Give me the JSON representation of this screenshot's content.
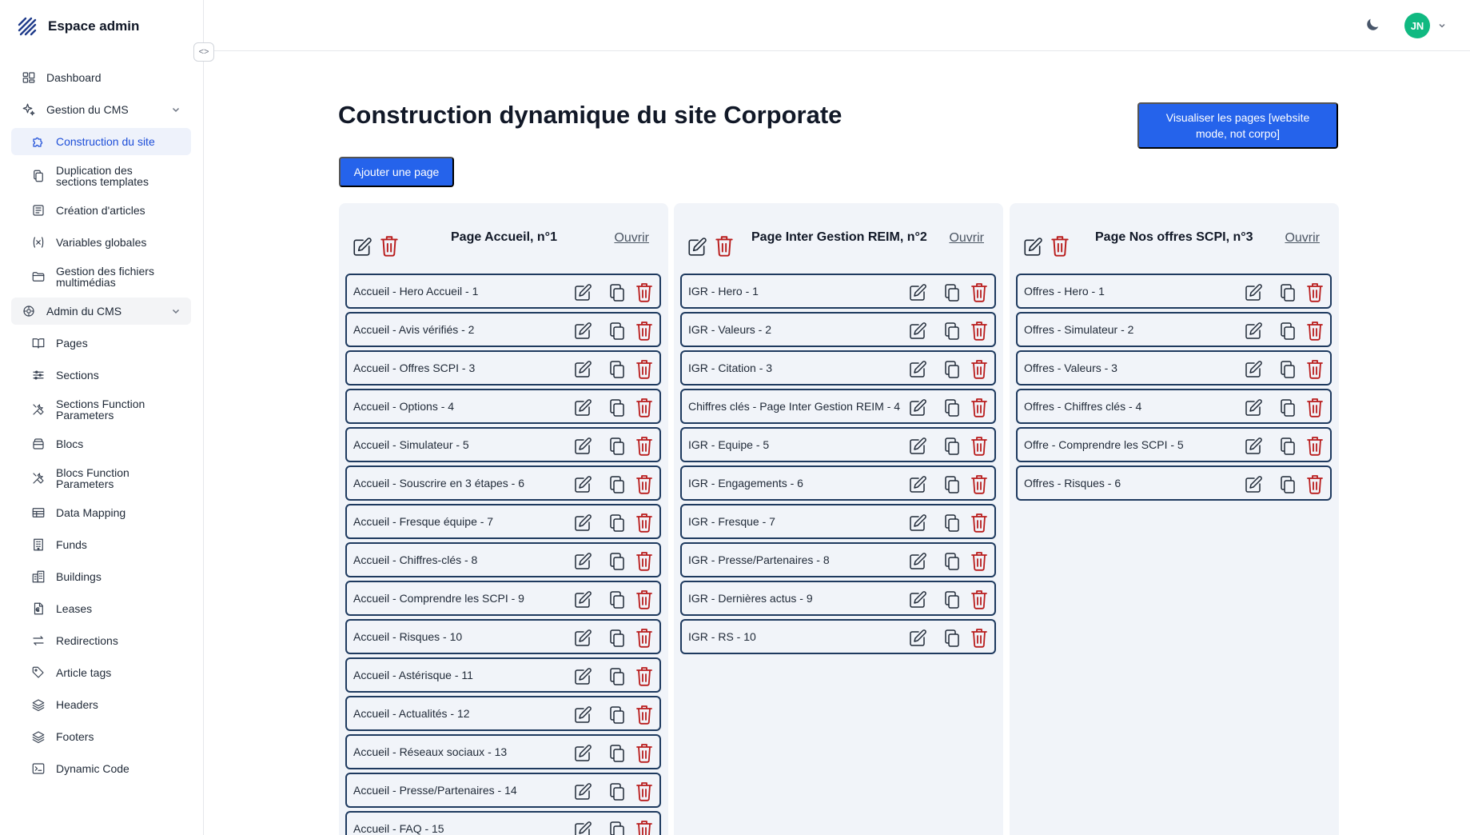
{
  "app": {
    "title": "Espace admin"
  },
  "topbar": {
    "avatar_initials": "JN",
    "theme_icon": "moon-icon"
  },
  "sidebar": {
    "items": [
      {
        "label": "Dashboard",
        "icon": "dashboard-icon",
        "type": "item"
      },
      {
        "label": "Gestion du CMS",
        "icon": "sparkles-icon",
        "type": "group"
      },
      {
        "label": "Construction du site",
        "icon": "puzzle-icon",
        "type": "sub",
        "active": true
      },
      {
        "label": "Duplication des sections templates",
        "icon": "copy-icon",
        "type": "sub"
      },
      {
        "label": "Création d'articles",
        "icon": "newspaper-icon",
        "type": "sub"
      },
      {
        "label": "Variables globales",
        "icon": "variable-icon",
        "type": "sub"
      },
      {
        "label": "Gestion des fichiers multimédias",
        "icon": "folder-icon",
        "type": "sub"
      },
      {
        "label": "Admin du CMS",
        "icon": "shield-icon",
        "type": "group"
      },
      {
        "label": "Pages",
        "icon": "book-icon",
        "type": "sub"
      },
      {
        "label": "Sections",
        "icon": "sliders-icon",
        "type": "sub"
      },
      {
        "label": "Sections Function Parameters",
        "icon": "tools-icon",
        "type": "sub"
      },
      {
        "label": "Blocs",
        "icon": "box-icon",
        "type": "sub"
      },
      {
        "label": "Blocs Function Parameters",
        "icon": "tools-icon",
        "type": "sub"
      },
      {
        "label": "Data Mapping",
        "icon": "table-icon",
        "type": "sub"
      },
      {
        "label": "Funds",
        "icon": "building-icon",
        "type": "sub"
      },
      {
        "label": "Buildings",
        "icon": "buildings-icon",
        "type": "sub"
      },
      {
        "label": "Leases",
        "icon": "lease-doc-icon",
        "type": "sub"
      },
      {
        "label": "Redirections",
        "icon": "arrows-icon",
        "type": "sub"
      },
      {
        "label": "Article tags",
        "icon": "tag-icon",
        "type": "sub"
      },
      {
        "label": "Headers",
        "icon": "layers-icon",
        "type": "sub"
      },
      {
        "label": "Footers",
        "icon": "layers-icon",
        "type": "sub"
      },
      {
        "label": "Dynamic Code",
        "icon": "terminal-icon",
        "type": "sub"
      }
    ]
  },
  "main": {
    "title": "Construction dynamique du site Corporate",
    "add_page_label": "Ajouter une page",
    "view_pages_label": "Visualiser les pages [website mode, not corpo]",
    "open_label": "Ouvrir",
    "columns": [
      {
        "title": "Page Accueil, n°1",
        "sections": [
          "Accueil - Hero Accueil - 1",
          "Accueil - Avis vérifiés - 2",
          "Accueil - Offres SCPI - 3",
          "Accueil - Options - 4",
          "Accueil - Simulateur - 5",
          "Accueil - Souscrire en 3 étapes - 6",
          "Accueil - Fresque équipe - 7",
          "Accueil - Chiffres-clés - 8",
          "Accueil - Comprendre les SCPI - 9",
          "Accueil - Risques - 10",
          "Accueil - Astérisque - 11",
          "Accueil - Actualités - 12",
          "Accueil - Réseaux sociaux - 13",
          "Accueil - Presse/Partenaires - 14",
          "Accueil - FAQ - 15"
        ]
      },
      {
        "title": "Page Inter Gestion REIM, n°2",
        "sections": [
          "IGR - Hero - 1",
          "IGR - Valeurs - 2",
          "IGR - Citation - 3",
          "Chiffres clés - Page Inter Gestion REIM - 4",
          "IGR - Equipe - 5",
          "IGR - Engagements - 6",
          "IGR - Fresque - 7",
          "IGR - Presse/Partenaires - 8",
          "IGR - Dernières actus - 9",
          "IGR - RS - 10"
        ]
      },
      {
        "title": "Page Nos offres SCPI, n°3",
        "sections": [
          "Offres - Hero - 1",
          "Offres - Simulateur - 2",
          "Offres - Valeurs - 3",
          "Offres - Chiffres clés - 4",
          "Offre - Comprendre les SCPI - 5",
          "Offres - Risques - 6"
        ]
      }
    ]
  },
  "colors": {
    "primary": "#2563eb",
    "danger": "#b91c1c",
    "border": "#1e3a5f",
    "column_bg": "#f1f4f9",
    "avatar_bg": "#10b981"
  }
}
